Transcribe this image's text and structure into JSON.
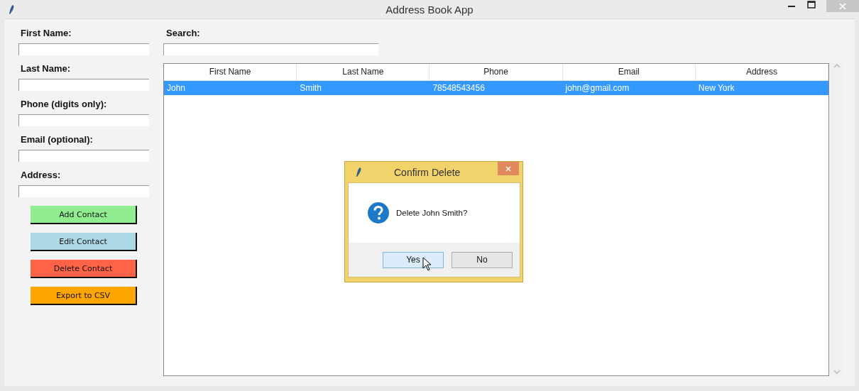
{
  "window": {
    "title": "Address Book App"
  },
  "form": {
    "fields": [
      {
        "label": "First Name:"
      },
      {
        "label": "Last Name:"
      },
      {
        "label": "Phone (digits only):"
      },
      {
        "label": "Email (optional):"
      },
      {
        "label": "Address:"
      }
    ],
    "buttons": [
      {
        "label": "Add Contact",
        "color": "#90ee90"
      },
      {
        "label": "Edit Contact",
        "color": "#add8e6"
      },
      {
        "label": "Delete Contact",
        "color": "#ff6347"
      },
      {
        "label": "Export to CSV",
        "color": "#ffa500"
      }
    ]
  },
  "search": {
    "label": "Search:"
  },
  "table": {
    "columns": [
      "First Name",
      "Last Name",
      "Phone",
      "Email",
      "Address"
    ],
    "rows": [
      {
        "cells": [
          "John",
          "Smith",
          "78548543456",
          "john@gmail.com",
          "New York"
        ],
        "selected": true
      }
    ]
  },
  "dialog": {
    "title": "Confirm Delete",
    "message": "Delete John Smith?",
    "buttons": [
      {
        "label": "Yes",
        "focused": true
      },
      {
        "label": "No",
        "focused": false
      }
    ]
  }
}
